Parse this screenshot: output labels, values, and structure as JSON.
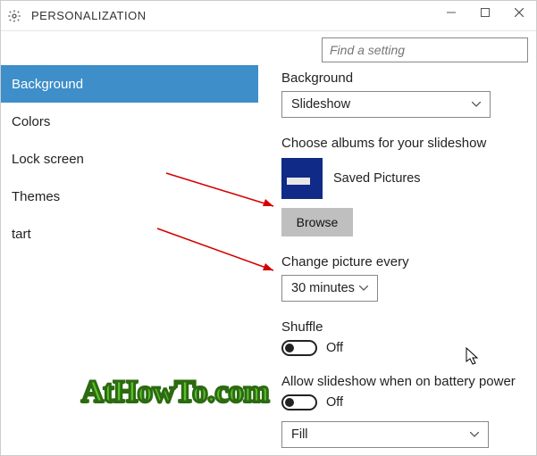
{
  "title": "PERSONALIZATION",
  "search": {
    "placeholder": "Find a setting"
  },
  "sidebar": {
    "items": [
      {
        "label": "Background",
        "selected": true
      },
      {
        "label": "Colors"
      },
      {
        "label": "Lock screen"
      },
      {
        "label": "Themes"
      },
      {
        "label": "tart"
      }
    ]
  },
  "content": {
    "background_label": "Background",
    "background_value": "Slideshow",
    "albums_label": "Choose albums for your slideshow",
    "album_name": "Saved Pictures",
    "browse_label": "Browse",
    "change_label": "Change picture every",
    "change_value": "30 minutes",
    "shuffle_label": "Shuffle",
    "shuffle_value": "Off",
    "battery_label": "Allow slideshow when on battery power",
    "battery_value": "Off",
    "fit_value": "Fill"
  },
  "watermark": "AtHowTo.com"
}
